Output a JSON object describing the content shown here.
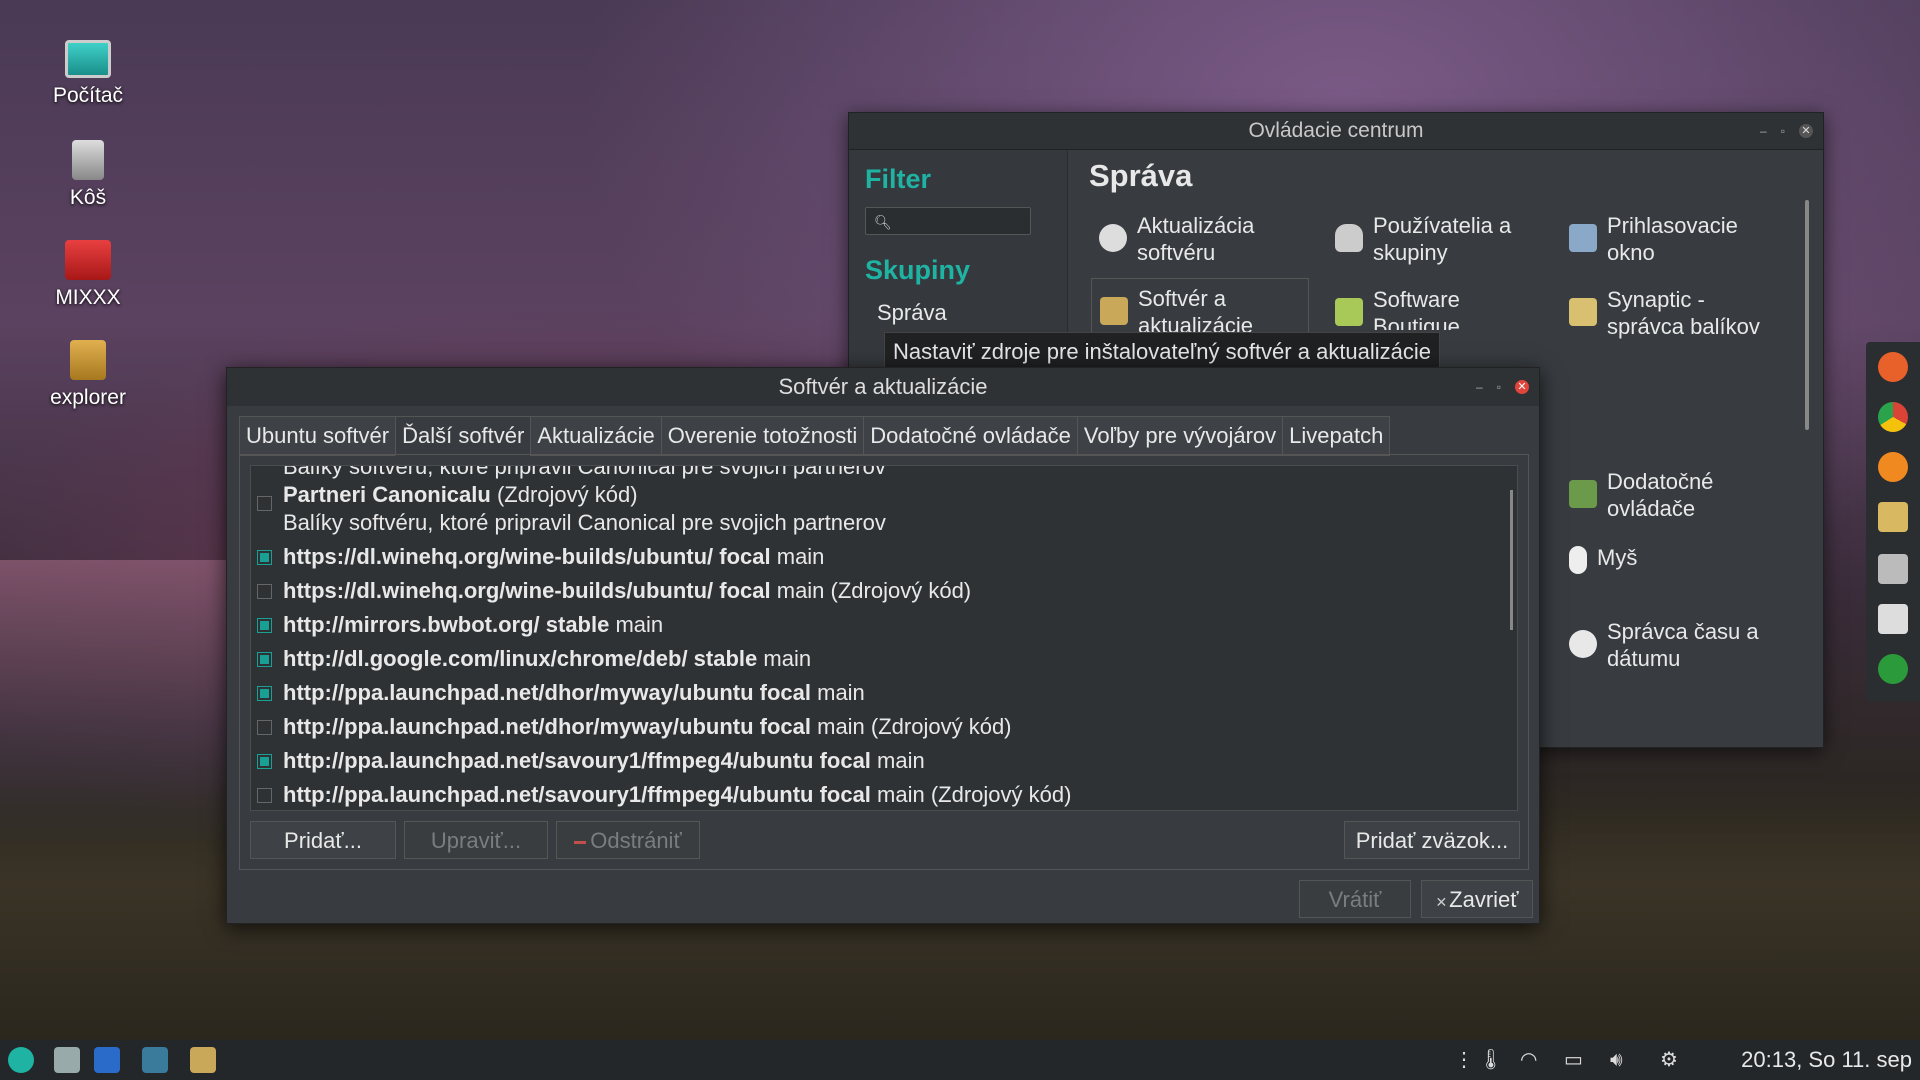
{
  "desktop": {
    "icons": [
      {
        "label": "Počítač"
      },
      {
        "label": "Kôš"
      },
      {
        "label": "MIXXX"
      },
      {
        "label": "explorer"
      }
    ]
  },
  "control_center": {
    "title": "Ovládacie centrum",
    "filter_heading": "Filter",
    "groups_heading": "Skupiny",
    "group_item": "Správa",
    "section_title": "Správa",
    "items": [
      {
        "line1": "Aktualizácia",
        "line2": "softvéru"
      },
      {
        "line1": "Používatelia a",
        "line2": "skupiny"
      },
      {
        "line1": "Prihlasovacie",
        "line2": "okno"
      },
      {
        "line1": "Softvér a",
        "line2": "aktualizácie"
      },
      {
        "line1": "Software",
        "line2": "Boutique"
      },
      {
        "line1": "Synaptic -",
        "line2": "správca balíkov"
      },
      {
        "line1": "Dodatočné",
        "line2": "ovládače"
      },
      {
        "line1": "Myš",
        "line2": ""
      },
      {
        "line1": "Správca času a",
        "line2": "dátumu"
      }
    ]
  },
  "tooltip": "Nastaviť zdroje pre inštalovateľný softvér a aktualizácie",
  "software_dialog": {
    "title": "Softvér a aktualizácie",
    "tabs": [
      "Ubuntu softvér",
      "Ďalší softvér",
      "Aktualizácie",
      "Overenie totožnosti",
      "Dodatočné ovládače",
      "Voľby pre vývojárov",
      "Livepatch"
    ],
    "active_tab": "Ďalší softvér",
    "partial_top_row": "Balíky softvéru, ktoré pripravil Canonical pre svojich partnerov",
    "sources": [
      {
        "checked": false,
        "bold": "Partneri Canonicalu",
        "rest": " (Zdrojový kód)",
        "desc": "Balíky softvéru, ktoré pripravil Canonical pre svojich partnerov"
      },
      {
        "checked": true,
        "bold": "https://dl.winehq.org/wine-builds/ubuntu/ focal",
        "rest": " main"
      },
      {
        "checked": false,
        "bold": "https://dl.winehq.org/wine-builds/ubuntu/ focal",
        "rest": " main (Zdrojový kód)"
      },
      {
        "checked": true,
        "bold": "http://mirrors.bwbot.org/ stable",
        "rest": " main"
      },
      {
        "checked": true,
        "bold": "http://dl.google.com/linux/chrome/deb/ stable",
        "rest": " main"
      },
      {
        "checked": true,
        "bold": "http://ppa.launchpad.net/dhor/myway/ubuntu focal",
        "rest": " main"
      },
      {
        "checked": false,
        "bold": "http://ppa.launchpad.net/dhor/myway/ubuntu focal",
        "rest": " main (Zdrojový kód)"
      },
      {
        "checked": true,
        "bold": "http://ppa.launchpad.net/savoury1/ffmpeg4/ubuntu focal",
        "rest": " main"
      },
      {
        "checked": false,
        "bold": "http://ppa.launchpad.net/savoury1/ffmpeg4/ubuntu focal",
        "rest": " main (Zdrojový kód)"
      }
    ],
    "buttons": {
      "add": "Pridať...",
      "edit": "Upraviť...",
      "remove": "Odstrániť",
      "add_bundle": "Pridať zväzok...",
      "revert": "Vrátiť",
      "close": "Zavrieť"
    }
  },
  "taskbar": {
    "clock": "20:13, So 11. sep"
  }
}
